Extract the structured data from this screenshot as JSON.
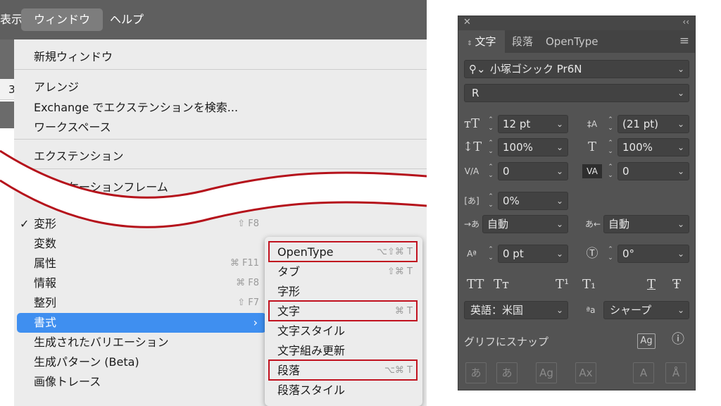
{
  "menubar": {
    "view": "表示",
    "window": "ウィンドウ",
    "help": "ヘルプ"
  },
  "app": {
    "ruler_value": "3"
  },
  "window_menu": {
    "new_window": "新規ウィンドウ",
    "arrange": "アレンジ",
    "exchange": "Exchange でエクステンションを検索...",
    "workspace": "ワークスペース",
    "extensions": "エクステンション",
    "app_frame": "アプリケーションフレーム",
    "app_frame_check": "✓"
  },
  "panels_menu": [
    {
      "label": "変形",
      "checked": "✓",
      "shortcut": "⇧ F8"
    },
    {
      "label": "変数",
      "shortcut": ""
    },
    {
      "label": "属性",
      "shortcut": "⌘ F11"
    },
    {
      "label": "情報",
      "shortcut": "⌘ F8"
    },
    {
      "label": "整列",
      "shortcut": "⇧ F7"
    },
    {
      "label": "書式",
      "arrow": "›"
    },
    {
      "label": "生成されたバリエーション",
      "shortcut": ""
    },
    {
      "label": "生成パターン (Beta)",
      "shortcut": ""
    },
    {
      "label": "画像トレース",
      "shortcut": ""
    }
  ],
  "submenu": [
    {
      "label": "OpenType",
      "shortcut": "⌥⇧⌘ T"
    },
    {
      "label": "タブ",
      "shortcut": "⇧⌘ T"
    },
    {
      "label": "字形",
      "shortcut": ""
    },
    {
      "label": "文字",
      "shortcut": "⌘ T"
    },
    {
      "label": "文字スタイル",
      "shortcut": ""
    },
    {
      "label": "文字組み更新",
      "shortcut": ""
    },
    {
      "label": "段落",
      "shortcut": "⌥⌘ T"
    },
    {
      "label": "段落スタイル",
      "shortcut": ""
    }
  ],
  "panel": {
    "close": "✕",
    "collapse": "‹‹",
    "tabs": [
      "文字",
      "段落",
      "OpenType"
    ],
    "menu_icon": "≡",
    "font_family": "小塚ゴシック Pr6N",
    "font_style": "R",
    "font_size": "12 pt",
    "leading": "(21 pt)",
    "vertical_scale": "100%",
    "horizontal_scale": "100%",
    "kerning": "0",
    "tracking": "0",
    "tsume": "0%",
    "aki_before": "自動",
    "aki_after": "自動",
    "baseline_shift": "0 pt",
    "rotation": "0°",
    "tt_buttons": [
      "TT",
      "Tт",
      "T¹",
      "T₁",
      "T",
      "Ŧ"
    ],
    "language": "英語：米国",
    "antialias_icon": "ªa",
    "antialias": "シャープ",
    "snap_label": "グリフにスナップ",
    "snap_glyph_icon": "Ag",
    "info_icon": "ⓘ",
    "snap_buttons": [
      "あ",
      "あ",
      "Ag",
      "Ax",
      "A",
      "Å"
    ]
  },
  "colors": {
    "highlight": "#3f8ff0",
    "redbox": "#c1121f",
    "panel_bg": "#535353"
  }
}
